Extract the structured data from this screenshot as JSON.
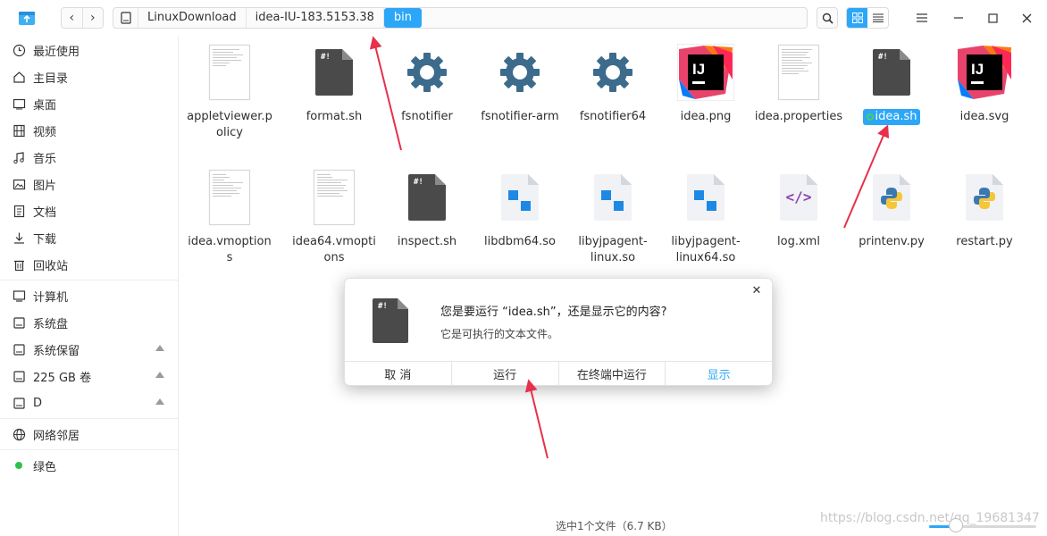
{
  "titlebar": {
    "breadcrumbs": [
      "LinuxDownload",
      "idea-IU-183.5153.38",
      "bin"
    ]
  },
  "sidebar": {
    "items": [
      {
        "label": "最近使用",
        "icon": "clock-icon"
      },
      {
        "label": "主目录",
        "icon": "home-icon"
      },
      {
        "label": "桌面",
        "icon": "desktop-icon"
      },
      {
        "label": "视频",
        "icon": "video-icon"
      },
      {
        "label": "音乐",
        "icon": "music-icon"
      },
      {
        "label": "图片",
        "icon": "picture-icon"
      },
      {
        "label": "文档",
        "icon": "document-icon"
      },
      {
        "label": "下载",
        "icon": "download-icon"
      },
      {
        "label": "回收站",
        "icon": "trash-icon"
      }
    ],
    "devices": [
      {
        "label": "计算机",
        "icon": "computer-icon"
      },
      {
        "label": "系统盘",
        "icon": "disk-icon"
      },
      {
        "label": "系统保留",
        "icon": "disk-icon"
      },
      {
        "label": "225 GB 卷",
        "icon": "disk-icon"
      },
      {
        "label": "D",
        "icon": "disk-icon"
      }
    ],
    "network": {
      "label": "网络邻居",
      "icon": "network-icon"
    },
    "tag": {
      "label": "绿色",
      "color": "#2ec24b"
    }
  },
  "files": [
    {
      "name": "appletviewer.policy",
      "line1": "appletviewer.p",
      "line2": "olicy",
      "kind": "text"
    },
    {
      "name": "format.sh",
      "line1": "format.sh",
      "line2": "",
      "kind": "script"
    },
    {
      "name": "fsnotifier",
      "line1": "fsnotifier",
      "line2": "",
      "kind": "gear"
    },
    {
      "name": "fsnotifier-arm",
      "line1": "fsnotifier-arm",
      "line2": "",
      "kind": "gear"
    },
    {
      "name": "fsnotifier64",
      "line1": "fsnotifier64",
      "line2": "",
      "kind": "gear"
    },
    {
      "name": "idea.png",
      "line1": "idea.png",
      "line2": "",
      "kind": "ij"
    },
    {
      "name": "idea.properties",
      "line1": "idea.properties",
      "line2": "",
      "kind": "text"
    },
    {
      "name": "idea.sh",
      "line1": "idea.sh",
      "line2": "",
      "kind": "script",
      "selected": true
    },
    {
      "name": "idea.svg",
      "line1": "idea.svg",
      "line2": "",
      "kind": "ij"
    },
    {
      "name": "idea.vmoptions",
      "line1": "idea.vmoption",
      "line2": "s",
      "kind": "text"
    },
    {
      "name": "idea64.vmoptions",
      "line1": "idea64.vmopti",
      "line2": "ons",
      "kind": "text"
    },
    {
      "name": "inspect.sh",
      "line1": "inspect.sh",
      "line2": "",
      "kind": "script"
    },
    {
      "name": "libdbm64.so",
      "line1": "libdbm64.so",
      "line2": "",
      "kind": "lib"
    },
    {
      "name": "libyjpagent-linux.so",
      "line1": "libyjpagent-",
      "line2": "linux.so",
      "kind": "lib"
    },
    {
      "name": "libyjpagent-linux64.so",
      "line1": "libyjpagent-",
      "line2": "linux64.so",
      "kind": "lib"
    },
    {
      "name": "log.xml",
      "line1": "log.xml",
      "line2": "",
      "kind": "xml"
    },
    {
      "name": "printenv.py",
      "line1": "printenv.py",
      "line2": "",
      "kind": "python"
    },
    {
      "name": "restart.py",
      "line1": "restart.py",
      "line2": "",
      "kind": "python"
    }
  ],
  "dialog": {
    "title": "您是要运行 “idea.sh”，还是显示它的内容?",
    "message": "它是可执行的文本文件。",
    "buttons": [
      "取 消",
      "运行",
      "在终端中运行",
      "显示"
    ]
  },
  "status": {
    "text": "选中1个文件（6.7 KB）",
    "zoom_level": 0.25
  },
  "watermark": "https://blog.csdn.net/qq_19681347",
  "colors": {
    "accent": "#2ca7f8",
    "gear": "#3d6b8c",
    "arrow": "#e8304b"
  }
}
